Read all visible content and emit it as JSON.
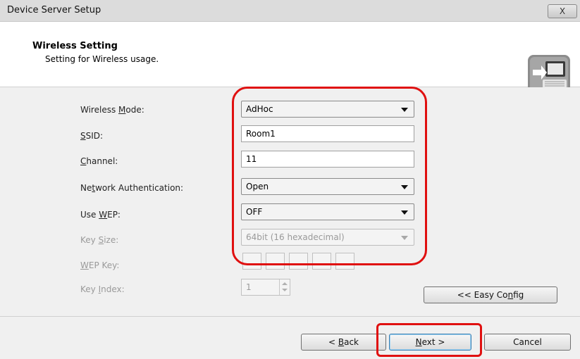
{
  "window": {
    "title": "Device Server Setup",
    "close_label": "X"
  },
  "header": {
    "title": "Wireless Setting",
    "subtitle": "Setting for Wireless usage.",
    "icon": "computer-setup-icon"
  },
  "form": {
    "wireless_mode": {
      "label_pre": "Wireless ",
      "label_key": "M",
      "label_post": "ode:",
      "value": "AdHoc"
    },
    "ssid": {
      "label_key": "S",
      "label_post": "SID:",
      "value": "Room1"
    },
    "channel": {
      "label_key": "C",
      "label_post": "hannel:",
      "value": "11"
    },
    "network_auth": {
      "label_pre": "Ne",
      "label_key": "t",
      "label_post": "work Authentication:",
      "value": "Open"
    },
    "use_wep": {
      "label_pre": "Use ",
      "label_key": "W",
      "label_post": "EP:",
      "value": "OFF"
    },
    "key_size": {
      "label_pre": "Key ",
      "label_key": "S",
      "label_post": "ize:",
      "value": "64bit (16 hexadecimal)"
    },
    "wep_key": {
      "label_key": "W",
      "label_post": "EP Key:",
      "values": [
        "",
        "",
        "",
        "",
        ""
      ]
    },
    "key_index": {
      "label_pre": "Key ",
      "label_key": "I",
      "label_post": "ndex:",
      "value": "1"
    }
  },
  "buttons": {
    "easy_config": {
      "pre": "<< Easy Co",
      "key": "n",
      "post": "fig"
    },
    "back": {
      "pre": "< ",
      "key": "B",
      "post": "ack"
    },
    "next": {
      "pre": "",
      "key": "N",
      "post": "ext >"
    },
    "cancel": "Cancel"
  },
  "colors": {
    "highlight": "#e01010",
    "header_bg": "#ffffff",
    "dialog_bg": "#f0f0f0"
  }
}
